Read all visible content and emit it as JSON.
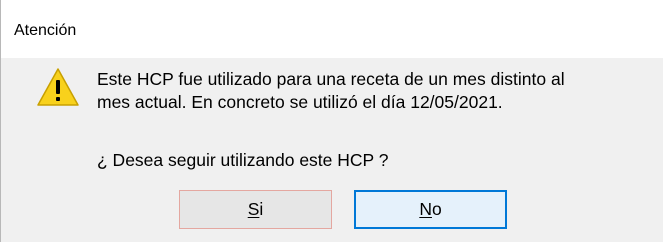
{
  "dialog": {
    "title": "Atención",
    "icon": "warning-icon",
    "message_line1": "Este HCP fue utilizado para una receta de un mes distinto al",
    "message_line2": "mes actual. En concreto se utilizó el día 12/05/2021.",
    "question": "¿ Desea seguir utilizando este HCP ?",
    "buttons": {
      "yes_accel": "S",
      "yes_rest": "i",
      "no_accel": "N",
      "no_rest": "o"
    },
    "colors": {
      "warning_fill": "#f8d11c",
      "warning_outline": "#c8a000",
      "focus_border": "#0078d7"
    }
  }
}
